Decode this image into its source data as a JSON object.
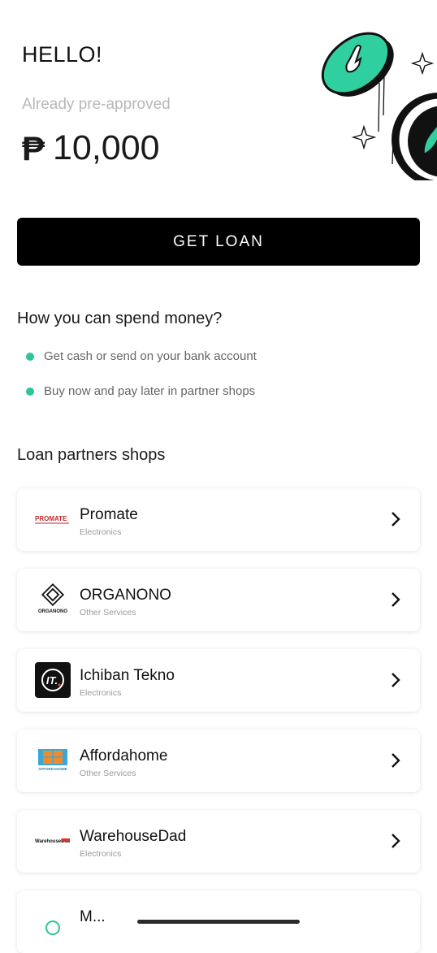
{
  "hero": {
    "greeting": "HELLO!",
    "preapproved_label": "Already pre-approved",
    "currency_symbol": "₱",
    "amount": "10,000"
  },
  "primary_action": {
    "label": "GET LOAN"
  },
  "spend_section": {
    "title": "How you can spend money?",
    "items": [
      "Get cash or send on your bank account",
      "Buy now and pay later in partner shops"
    ]
  },
  "partners": {
    "title": "Loan partners shops",
    "shops": [
      {
        "name": "Promate",
        "category": "Electronics",
        "logo_text": "PROMATE"
      },
      {
        "name": "ORGANONO",
        "category": "Other Services",
        "logo_text": "ORGANONO"
      },
      {
        "name": "Ichiban Tekno",
        "category": "Electronics",
        "logo_text": "IT."
      },
      {
        "name": "Affordahome",
        "category": "Other Services",
        "logo_text": "AFFORDAHOME"
      },
      {
        "name": "WarehouseDad",
        "category": "Electronics",
        "logo_text": "WarehouseDad"
      },
      {
        "name": "M...",
        "category": ""
      }
    ]
  },
  "colors": {
    "accent": "#2ec59a",
    "primary_button": "#000000",
    "muted_text": "#b8b8b8"
  }
}
